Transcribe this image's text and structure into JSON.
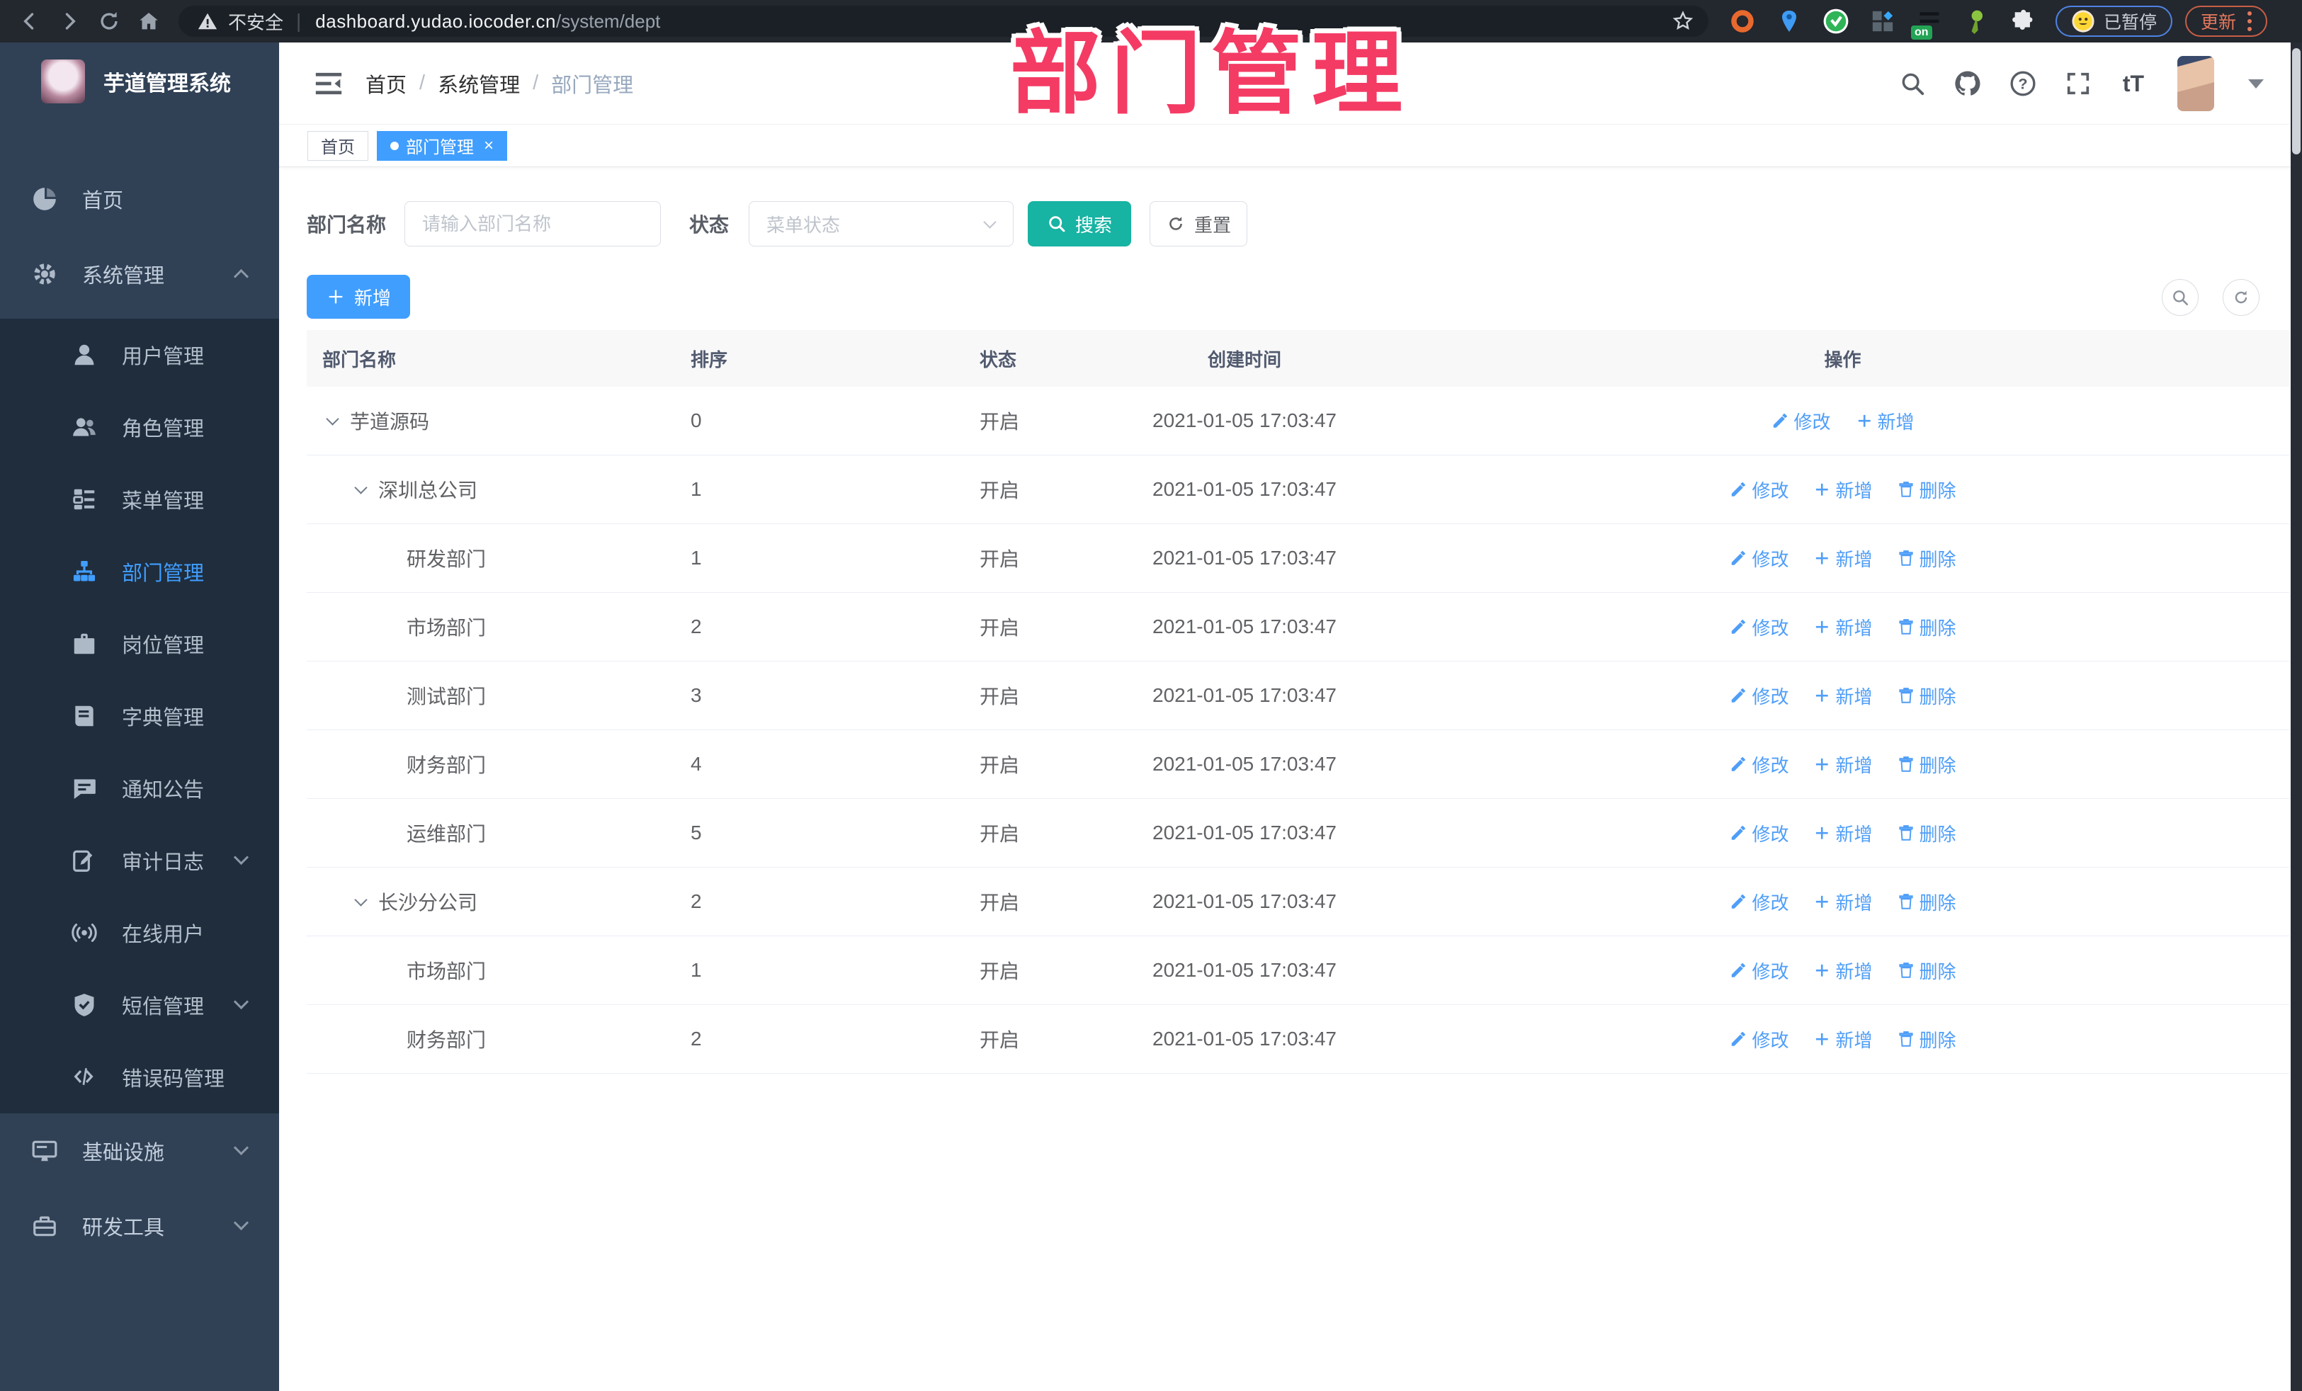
{
  "theme": {
    "accent_blue": "#409eff",
    "search_teal": "#17b3a3",
    "overlay_pink": "#f43b64",
    "sidebar_bg": "#304156",
    "submenu_bg": "#1f2d3d"
  },
  "overlay_title": "部门管理",
  "browser": {
    "security_warning": "不安全",
    "url_host": "dashboard.yudao.iocoder.cn",
    "url_path": "/system/dept",
    "paused_badge": "已暂停",
    "update_button": "更新"
  },
  "sidebar": {
    "app_title": "芋道管理系统",
    "items": [
      {
        "label": "首页",
        "icon": "dashboard-icon",
        "level": 0
      },
      {
        "label": "系统管理",
        "icon": "gear-icon",
        "level": 0,
        "chevron": "up"
      },
      {
        "label": "用户管理",
        "icon": "user-icon",
        "level": 1
      },
      {
        "label": "角色管理",
        "icon": "users-icon",
        "level": 1
      },
      {
        "label": "菜单管理",
        "icon": "menu-icon",
        "level": 1
      },
      {
        "label": "部门管理",
        "icon": "dept-icon",
        "level": 1,
        "active": true
      },
      {
        "label": "岗位管理",
        "icon": "post-icon",
        "level": 1
      },
      {
        "label": "字典管理",
        "icon": "dict-icon",
        "level": 1
      },
      {
        "label": "通知公告",
        "icon": "notice-icon",
        "level": 1
      },
      {
        "label": "审计日志",
        "icon": "log-icon",
        "level": 1,
        "chevron": "down"
      },
      {
        "label": "在线用户",
        "icon": "online-icon",
        "level": 1
      },
      {
        "label": "短信管理",
        "icon": "sms-icon",
        "level": 1,
        "chevron": "down"
      },
      {
        "label": "错误码管理",
        "icon": "code-icon",
        "level": 1
      },
      {
        "label": "基础设施",
        "icon": "infra-icon",
        "level": 0,
        "chevron": "down"
      },
      {
        "label": "研发工具",
        "icon": "tools-icon",
        "level": 0,
        "chevron": "down"
      }
    ]
  },
  "header": {
    "breadcrumb": [
      "首页",
      "系统管理",
      "部门管理"
    ]
  },
  "tags": [
    {
      "label": "首页",
      "active": false,
      "closable": false
    },
    {
      "label": "部门管理",
      "active": true,
      "closable": true
    }
  ],
  "filter": {
    "name_label": "部门名称",
    "name_placeholder": "请输入部门名称",
    "status_label": "状态",
    "status_placeholder": "菜单状态",
    "search_label": "搜索",
    "reset_label": "重置"
  },
  "toolbar": {
    "add_label": "新增"
  },
  "table": {
    "columns": [
      "部门名称",
      "排序",
      "状态",
      "创建时间",
      "操作"
    ],
    "action_labels": {
      "edit": "修改",
      "add": "新增",
      "delete": "删除"
    },
    "rows": [
      {
        "name": "芋道源码",
        "level": 0,
        "expandable": true,
        "sort": "0",
        "status": "开启",
        "created": "2021-01-05 17:03:47",
        "actions": [
          "edit",
          "add"
        ]
      },
      {
        "name": "深圳总公司",
        "level": 1,
        "expandable": true,
        "sort": "1",
        "status": "开启",
        "created": "2021-01-05 17:03:47",
        "actions": [
          "edit",
          "add",
          "delete"
        ]
      },
      {
        "name": "研发部门",
        "level": 2,
        "expandable": false,
        "sort": "1",
        "status": "开启",
        "created": "2021-01-05 17:03:47",
        "actions": [
          "edit",
          "add",
          "delete"
        ]
      },
      {
        "name": "市场部门",
        "level": 2,
        "expandable": false,
        "sort": "2",
        "status": "开启",
        "created": "2021-01-05 17:03:47",
        "actions": [
          "edit",
          "add",
          "delete"
        ]
      },
      {
        "name": "测试部门",
        "level": 2,
        "expandable": false,
        "sort": "3",
        "status": "开启",
        "created": "2021-01-05 17:03:47",
        "actions": [
          "edit",
          "add",
          "delete"
        ]
      },
      {
        "name": "财务部门",
        "level": 2,
        "expandable": false,
        "sort": "4",
        "status": "开启",
        "created": "2021-01-05 17:03:47",
        "actions": [
          "edit",
          "add",
          "delete"
        ]
      },
      {
        "name": "运维部门",
        "level": 2,
        "expandable": false,
        "sort": "5",
        "status": "开启",
        "created": "2021-01-05 17:03:47",
        "actions": [
          "edit",
          "add",
          "delete"
        ]
      },
      {
        "name": "长沙分公司",
        "level": 1,
        "expandable": true,
        "sort": "2",
        "status": "开启",
        "created": "2021-01-05 17:03:47",
        "actions": [
          "edit",
          "add",
          "delete"
        ]
      },
      {
        "name": "市场部门",
        "level": 2,
        "expandable": false,
        "sort": "1",
        "status": "开启",
        "created": "2021-01-05 17:03:47",
        "actions": [
          "edit",
          "add",
          "delete"
        ]
      },
      {
        "name": "财务部门",
        "level": 2,
        "expandable": false,
        "sort": "2",
        "status": "开启",
        "created": "2021-01-05 17:03:47",
        "actions": [
          "edit",
          "add",
          "delete"
        ]
      }
    ]
  }
}
